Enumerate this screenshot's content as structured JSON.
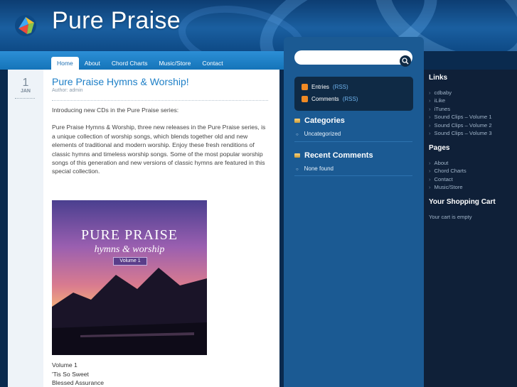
{
  "site": {
    "title": "Pure Praise"
  },
  "nav": [
    {
      "label": "Home",
      "active": true
    },
    {
      "label": "About"
    },
    {
      "label": "Chord Charts"
    },
    {
      "label": "Music/Store"
    },
    {
      "label": "Contact"
    }
  ],
  "post": {
    "day": "1",
    "month": "JAN",
    "title": "Pure Praise Hymns & Worship!",
    "author": "Author: admin",
    "paragraphs": [
      "Introducing new CDs in the Pure Praise series:",
      "Pure Praise Hymns & Worship, three new releases in the Pure Praise series, is a unique collection of worship songs, which blends together old and new elements of traditional and modern worship. Enjoy these fresh renditions of classic hymns and timeless worship songs. Some of the most popular worship songs of this generation and new versions of classic hymns are featured in this special collection."
    ],
    "album": {
      "title": "PURE PRAISE",
      "subtitle": "hymns & worship",
      "volume": "Volume 1"
    },
    "tracks": [
      "Volume 1",
      "'Tis So Sweet",
      "Blessed Assurance"
    ]
  },
  "sidebar": {
    "rss": [
      {
        "label": "Entries",
        "link": "(RSS)"
      },
      {
        "label": "Comments",
        "link": "(RSS)"
      }
    ],
    "categories": {
      "heading": "Categories",
      "items": [
        "Uncategorized"
      ]
    },
    "recent_comments": {
      "heading": "Recent Comments",
      "items": [
        "None found"
      ]
    }
  },
  "right": {
    "links": {
      "heading": "Links",
      "items": [
        "cdbaby",
        "iLike",
        "iTunes",
        "Sound Clips – Volume 1",
        "Sound Clips – Volume 2",
        "Sound Clips – Volume 3"
      ]
    },
    "pages": {
      "heading": "Pages",
      "items": [
        "About",
        "Chord Charts",
        "Contact",
        "Music/Store"
      ]
    },
    "cart": {
      "heading": "Your Shopping Cart",
      "text": "Your cart is empty"
    }
  },
  "icons": {
    "logo": "dove-logo-icon",
    "search": "search-icon",
    "rss": "rss-icon",
    "heading": "folder-icon"
  }
}
